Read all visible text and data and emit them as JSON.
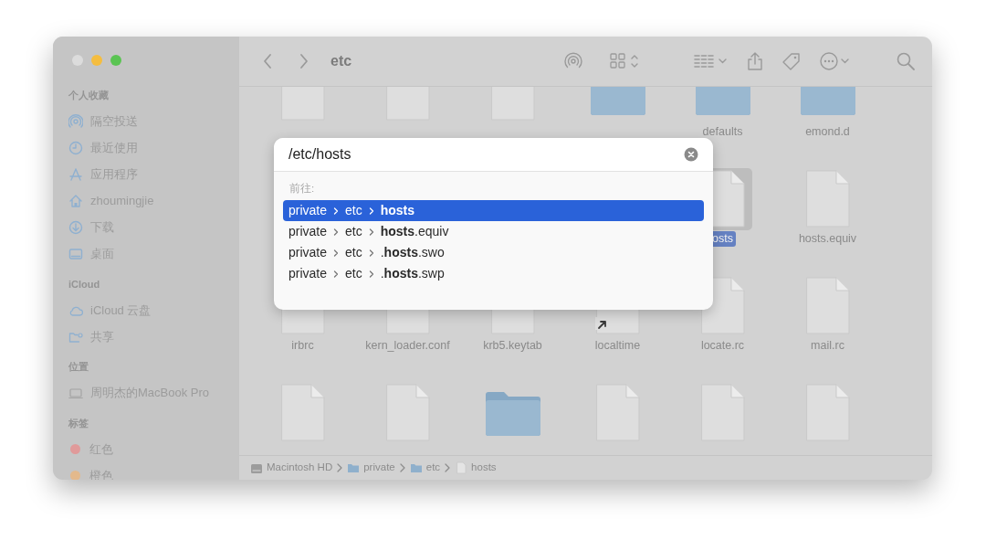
{
  "window": {
    "title": "etc"
  },
  "sidebar": {
    "sections": [
      {
        "heading": "个人收藏",
        "items": [
          {
            "label": "隔空投送",
            "kind": "airdrop"
          },
          {
            "label": "最近使用",
            "kind": "recents"
          },
          {
            "label": "应用程序",
            "kind": "applications"
          },
          {
            "label": "zhoumingjie",
            "kind": "home"
          },
          {
            "label": "下载",
            "kind": "downloads"
          },
          {
            "label": "桌面",
            "kind": "desktop"
          }
        ]
      },
      {
        "heading": "iCloud",
        "items": [
          {
            "label": "iCloud 云盘",
            "kind": "cloud"
          },
          {
            "label": "共享",
            "kind": "shared"
          }
        ]
      },
      {
        "heading": "位置",
        "items": [
          {
            "label": "周明杰的MacBook Pro",
            "kind": "computer"
          }
        ]
      },
      {
        "heading": "标签",
        "items": [
          {
            "label": "红色",
            "kind": "tag",
            "color": "#e09a9a"
          },
          {
            "label": "橙色",
            "kind": "tag",
            "color": "#e3b98c"
          }
        ]
      }
    ]
  },
  "file_rows": [
    [
      {
        "kind": "document",
        "selected": false
      },
      {
        "kind": "document",
        "selected": false
      },
      {
        "kind": "document",
        "selected": false
      },
      {
        "kind": "folder",
        "selected": false
      },
      {
        "name": "defaults",
        "kind": "folder",
        "selected": false
      },
      {
        "name": "emond.d",
        "kind": "folder",
        "selected": false
      }
    ],
    [
      {
        "name": "osts",
        "kind": "document",
        "selected": true
      },
      {
        "name": "hosts.equiv",
        "kind": "document",
        "selected": false
      }
    ],
    [
      {
        "name": "irbrc",
        "kind": "document",
        "selected": false
      },
      {
        "name": "kern_loader.conf",
        "kind": "document",
        "selected": false
      },
      {
        "name": "krb5.keytab",
        "kind": "document",
        "selected": false
      },
      {
        "name": "localtime",
        "kind": "document",
        "selected": false,
        "alias": true
      },
      {
        "name": "locate.rc",
        "kind": "document",
        "selected": false
      },
      {
        "name": "mail.rc",
        "kind": "document",
        "selected": false
      }
    ],
    [
      {
        "kind": "document",
        "selected": false
      },
      {
        "kind": "document",
        "selected": false
      },
      {
        "kind": "folder",
        "selected": false
      },
      {
        "kind": "document",
        "selected": false
      },
      {
        "kind": "document",
        "selected": false
      },
      {
        "kind": "document",
        "selected": false
      }
    ]
  ],
  "path_bar": [
    {
      "label": "Macintosh HD",
      "kind": "disk"
    },
    {
      "label": "private",
      "kind": "folder"
    },
    {
      "label": "etc",
      "kind": "folder"
    },
    {
      "label": "hosts",
      "kind": "document"
    }
  ],
  "goto_dialog": {
    "value": "/etc/hosts",
    "heading": "前往:",
    "suggestions": [
      {
        "parts": [
          "private",
          "etc",
          "**hosts**"
        ],
        "selected": true
      },
      {
        "parts": [
          "private",
          "etc",
          "**hosts**.equiv"
        ],
        "selected": false
      },
      {
        "parts": [
          "private",
          "etc",
          ".**hosts**.swo"
        ],
        "selected": false
      },
      {
        "parts": [
          "private",
          "etc",
          ".**hosts**.swp"
        ],
        "selected": false
      }
    ]
  }
}
